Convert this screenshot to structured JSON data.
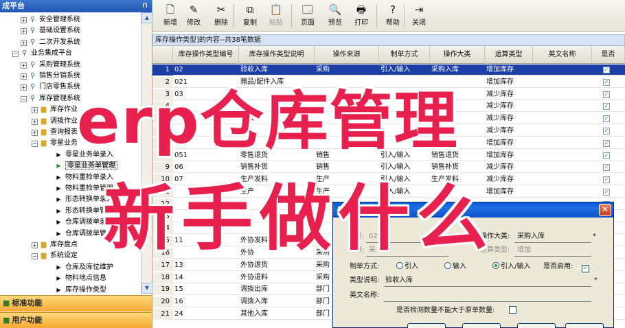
{
  "left_panel": {
    "title": "成平台",
    "pin": "⊓",
    "tree": [
      {
        "label": "安全管理系统",
        "icon": "app",
        "level": 1,
        "expander": "+"
      },
      {
        "label": "基础设置系统",
        "icon": "app",
        "level": 1,
        "expander": "+"
      },
      {
        "label": "二次开发系统",
        "icon": "app",
        "level": 1,
        "expander": "+"
      },
      {
        "label": "业务集成平台",
        "icon": "app",
        "level": 0,
        "expander": "−"
      },
      {
        "label": "采购管理系统",
        "icon": "app",
        "level": 1,
        "expander": "+"
      },
      {
        "label": "销售分销系统",
        "icon": "app",
        "level": 1,
        "expander": "+"
      },
      {
        "label": "门店零售系统",
        "icon": "app",
        "level": 1,
        "expander": "+"
      },
      {
        "label": "库存管理系统",
        "icon": "app",
        "level": 1,
        "expander": "−"
      },
      {
        "label": "库存作业",
        "icon": "folder",
        "level": 2,
        "expander": "+"
      },
      {
        "label": "调拨作业",
        "icon": "folder",
        "level": 2,
        "expander": "+"
      },
      {
        "label": "查询报表",
        "icon": "folder",
        "level": 2,
        "expander": "+"
      },
      {
        "label": "零星业务",
        "icon": "folder",
        "level": 2,
        "expander": "−"
      },
      {
        "label": "零星业务单录入",
        "icon": "leaf",
        "level": 3,
        "expander": ""
      },
      {
        "label": "零星业务单管理",
        "icon": "leaf-selected",
        "level": 3,
        "expander": "",
        "selected": true
      },
      {
        "label": "物料重检单录入",
        "icon": "leaf",
        "level": 3,
        "expander": ""
      },
      {
        "label": "物料重检单管理",
        "icon": "leaf",
        "level": 3,
        "expander": ""
      },
      {
        "label": "形态转换单录入",
        "icon": "leaf",
        "level": 3,
        "expander": ""
      },
      {
        "label": "形态转换单管理",
        "icon": "leaf",
        "level": 3,
        "expander": ""
      },
      {
        "label": "仓库调拨单录入",
        "icon": "leaf",
        "level": 3,
        "expander": ""
      },
      {
        "label": "仓库调拨单管理",
        "icon": "leaf",
        "level": 3,
        "expander": ""
      },
      {
        "label": "库存盘点",
        "icon": "folder",
        "level": 2,
        "expander": "+"
      },
      {
        "label": "系统设定",
        "icon": "folder",
        "level": 2,
        "expander": "−"
      },
      {
        "label": "仓库及库位维护",
        "icon": "leaf",
        "level": 3,
        "expander": ""
      },
      {
        "label": "物料地点信息",
        "icon": "leaf",
        "level": 3,
        "expander": ""
      },
      {
        "label": "库存操作类型",
        "icon": "leaf",
        "level": 3,
        "expander": ""
      }
    ],
    "bottom_buttons": [
      "标准功能",
      "用户功能"
    ]
  },
  "toolbar": [
    {
      "label": "新增",
      "icon": "new-doc-icon",
      "glyph": "🗋",
      "enabled": true
    },
    {
      "label": "修改",
      "icon": "edit-icon",
      "glyph": "✎",
      "enabled": true
    },
    {
      "label": "删除",
      "icon": "delete-icon",
      "glyph": "✂",
      "enabled": true
    },
    {
      "label": "复制",
      "icon": "copy-icon",
      "glyph": "⧉",
      "enabled": true
    },
    {
      "label": "粘贴",
      "icon": "paste-icon",
      "glyph": "📋",
      "enabled": false
    },
    {
      "label": "页面",
      "icon": "page-setup-icon",
      "glyph": "🗔",
      "enabled": true
    },
    {
      "label": "预览",
      "icon": "preview-icon",
      "glyph": "🔍",
      "enabled": true
    },
    {
      "label": "打印",
      "icon": "print-icon",
      "glyph": "🖶",
      "enabled": true
    },
    {
      "label": "帮助",
      "icon": "help-icon",
      "glyph": "?",
      "enabled": true
    },
    {
      "label": "关闭",
      "icon": "close-door-icon",
      "glyph": "⇥",
      "enabled": true
    }
  ],
  "grid": {
    "caption": "库存操作类型]的内容--共38笔数据",
    "columns": [
      "",
      "库存操作类型编号",
      "库存操作类型说明",
      "操作来源",
      "制单方式",
      "操作大类",
      "运算类型",
      "英文名称",
      "是否"
    ],
    "rows": [
      {
        "n": "1",
        "code": "02",
        "desc": "验收入库",
        "src": "采购",
        "mode": "引入/输入",
        "cat": "采购入库",
        "calc": "增加库存",
        "selected": true
      },
      {
        "n": "2",
        "code": "021",
        "desc": "赠品/配件入库",
        "src": "",
        "mode": "",
        "cat": "",
        "calc": "增加库存"
      },
      {
        "n": "3",
        "code": "03",
        "desc": "",
        "src": "",
        "mode": "",
        "cat": "",
        "calc": "减少库存"
      },
      {
        "n": "4",
        "code": "",
        "desc": "",
        "src": "",
        "mode": "",
        "cat": "",
        "calc": "减少库存"
      },
      {
        "n": "5",
        "code": "",
        "desc": "发货",
        "src": "",
        "mode": "",
        "cat": "",
        "calc": "减少库存"
      },
      {
        "n": "6",
        "code": "",
        "desc": "",
        "src": "",
        "mode": "",
        "cat": "",
        "calc": "减少库存"
      },
      {
        "n": "7",
        "code": "05",
        "desc": "",
        "src": "",
        "mode": "",
        "cat": "",
        "calc": "增加库存"
      },
      {
        "n": "8",
        "code": "051",
        "desc": "零售退货",
        "src": "销售",
        "mode": "引入/输入",
        "cat": "销售退货",
        "calc": "增加库存"
      },
      {
        "n": "9",
        "code": "06",
        "desc": "销售补货",
        "src": "销售",
        "mode": "引入/输入",
        "cat": "销售补货",
        "calc": "减少库存"
      },
      {
        "n": "10",
        "code": "07",
        "desc": "生产发料",
        "src": "生产",
        "mode": "引入/输入",
        "cat": "生产发料",
        "calc": "减少库存"
      },
      {
        "n": "11",
        "code": "",
        "desc": "生产",
        "src": "生产",
        "mode": "引入/输入",
        "cat": "",
        "calc": "增加库存"
      },
      {
        "n": "12",
        "code": "",
        "desc": "",
        "src": "",
        "mode": "",
        "cat": "",
        "calc": ""
      },
      {
        "n": "13",
        "code": "",
        "desc": "",
        "src": "",
        "mode": "",
        "cat": "",
        "calc": ""
      },
      {
        "n": "14",
        "code": "",
        "desc": "",
        "src": "",
        "mode": "",
        "cat": "",
        "calc": ""
      },
      {
        "n": "15",
        "code": "11",
        "desc": "外协发料",
        "src": "",
        "mode": "",
        "cat": "",
        "calc": ""
      },
      {
        "n": "16",
        "code": "",
        "desc": "外协",
        "src": "采购",
        "mode": "",
        "cat": "",
        "calc": ""
      },
      {
        "n": "17",
        "code": "13",
        "desc": "外协退货",
        "src": "采购",
        "mode": "",
        "cat": "",
        "calc": ""
      },
      {
        "n": "18",
        "code": "14",
        "desc": "外协退料",
        "src": "采购",
        "mode": "",
        "cat": "",
        "calc": ""
      },
      {
        "n": "19",
        "code": "15",
        "desc": "调拨出库",
        "src": "部门",
        "mode": "",
        "cat": "",
        "calc": ""
      },
      {
        "n": "20",
        "code": "16",
        "desc": "调拨入库",
        "src": "部门",
        "mode": "",
        "cat": "",
        "calc": ""
      },
      {
        "n": "21",
        "code": "24",
        "desc": "其他入库",
        "src": "部门",
        "mode": "",
        "cat": "",
        "calc": ""
      }
    ]
  },
  "dialog": {
    "title": "库存操作类型维护",
    "close_glyph": "✕",
    "code_label": "号:",
    "code_value": "02",
    "source_label": "源:",
    "source_value": "采",
    "op_cat_label": "操作大类:",
    "op_cat_value": "采购入库",
    "calc_label": "运算类型:",
    "calc_value": "增加",
    "mode_label": "制单方式:",
    "mode_options": [
      "引入",
      "输入",
      "引入/输入"
    ],
    "mode_selected": "引入/输入",
    "enabled_label": "是否启用:",
    "enabled": true,
    "desc_label": "类型说明:",
    "desc_value": "验收入库",
    "en_label": "英文名称:",
    "en_value": "",
    "check_label": "是否检测数量不能大于原单数量:",
    "check_value": false
  },
  "overlay": {
    "line1": "erp仓库管理",
    "line2": "新手做什么"
  },
  "colors": {
    "overlay_text": "#e8204e",
    "selection": "#1c3fa6",
    "title_bar": "#2456b1",
    "nav_button": "#f6a935"
  }
}
